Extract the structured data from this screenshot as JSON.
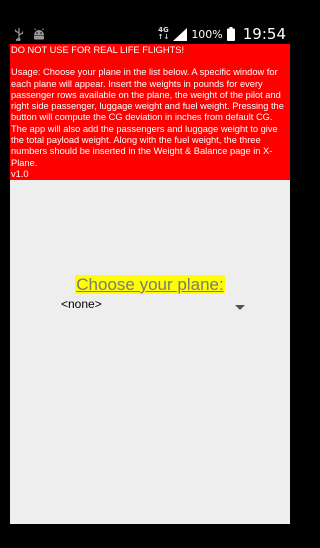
{
  "status_bar": {
    "network_label": "4G",
    "network_sub": "↑↓",
    "battery": "100%",
    "time": "19:54"
  },
  "warning": {
    "title": "DO NOT USE FOR REAL LIFE FLIGHTS!",
    "usage": "Usage: Choose your plane in the list below. A specific window for each plane will appear. Insert the weights in pounds for every passenger rows available on the plane, the weight of the pilot and right side passenger, luggage weight and fuel weight. Pressing the button will compute the CG deviation in inches from default CG. The app will also add the passengers and luggage weight to give the total payload weight. Along with the fuel weight, the three numbers should be inserted in the Weight & Balance page in X-Plane.",
    "version": " v1.0"
  },
  "choose_label": "Choose your plane:",
  "plane_select": {
    "value": "<none>"
  },
  "colors": {
    "warning_bg": "#ff0000",
    "highlight": "#ffff00",
    "screen_bg": "#eeeeee"
  }
}
